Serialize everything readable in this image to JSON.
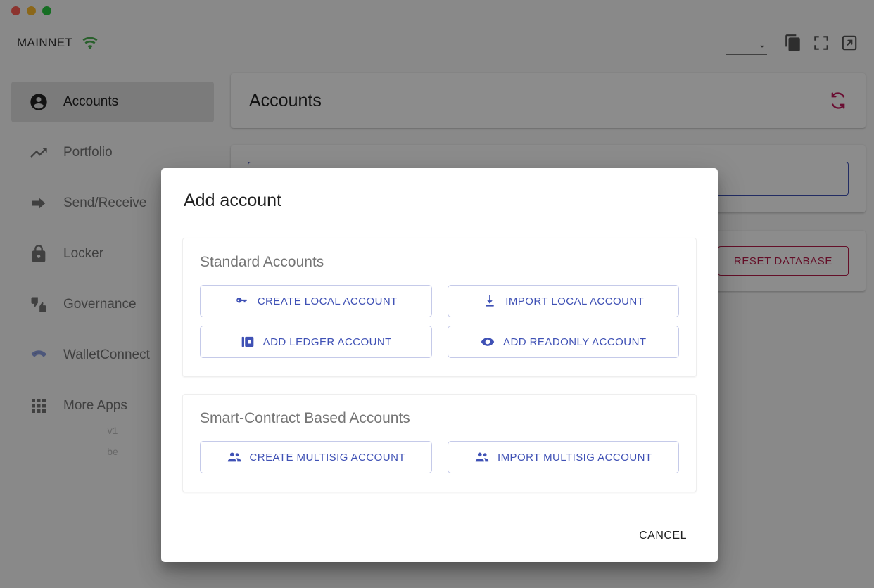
{
  "window": {
    "traffic_lights": [
      "close",
      "minimize",
      "maximize"
    ]
  },
  "topbar": {
    "network_label": "MAINNET",
    "wifi_icon": "wifi-icon",
    "wifi_color": "#4caf50",
    "network_select_value": "",
    "icons": [
      {
        "name": "copy-icon",
        "label": "Copy"
      },
      {
        "name": "fullscreen-icon",
        "label": "Fullscreen"
      },
      {
        "name": "open-external-icon",
        "label": "Open in new window"
      }
    ]
  },
  "sidebar": {
    "items": [
      {
        "label": "Accounts",
        "icon": "account-circle-icon",
        "active": true
      },
      {
        "label": "Portfolio",
        "icon": "trending-up-icon",
        "active": false
      },
      {
        "label": "Send/Receive",
        "icon": "arrow-forward-icon",
        "active": false
      },
      {
        "label": "Locker",
        "icon": "lock-icon",
        "active": false
      },
      {
        "label": "Governance",
        "icon": "thumbs-up-down-icon",
        "active": false
      },
      {
        "label": "WalletConnect",
        "icon": "walletconnect-icon",
        "active": false
      },
      {
        "label": "More Apps",
        "icon": "apps-grid-icon",
        "active": false
      }
    ],
    "version_line_1": "v1",
    "version_line_2": "be"
  },
  "main": {
    "page_title": "Accounts",
    "refresh_icon": "refresh-icon",
    "refresh_color": "#c2185b",
    "search_value": "",
    "search_placeholder": "",
    "reset_db_label": "RESET DATABASE",
    "reset_db_color": "#b71c4a"
  },
  "dialog": {
    "title": "Add account",
    "groups": [
      {
        "title": "Standard Accounts",
        "buttons": [
          {
            "label": "CREATE LOCAL ACCOUNT",
            "icon": "key-icon"
          },
          {
            "label": "IMPORT LOCAL ACCOUNT",
            "icon": "download-icon"
          },
          {
            "label": "ADD LEDGER ACCOUNT",
            "icon": "ledger-wallet-icon"
          },
          {
            "label": "ADD READONLY ACCOUNT",
            "icon": "eye-icon"
          }
        ]
      },
      {
        "title": "Smart-Contract Based Accounts",
        "buttons": [
          {
            "label": "CREATE MULTISIG ACCOUNT",
            "icon": "people-group-icon"
          },
          {
            "label": "IMPORT MULTISIG ACCOUNT",
            "icon": "people-group-icon"
          }
        ]
      }
    ],
    "cancel_label": "CANCEL",
    "accent_color": "#3f51b5",
    "border_color": "#c5cae9"
  }
}
